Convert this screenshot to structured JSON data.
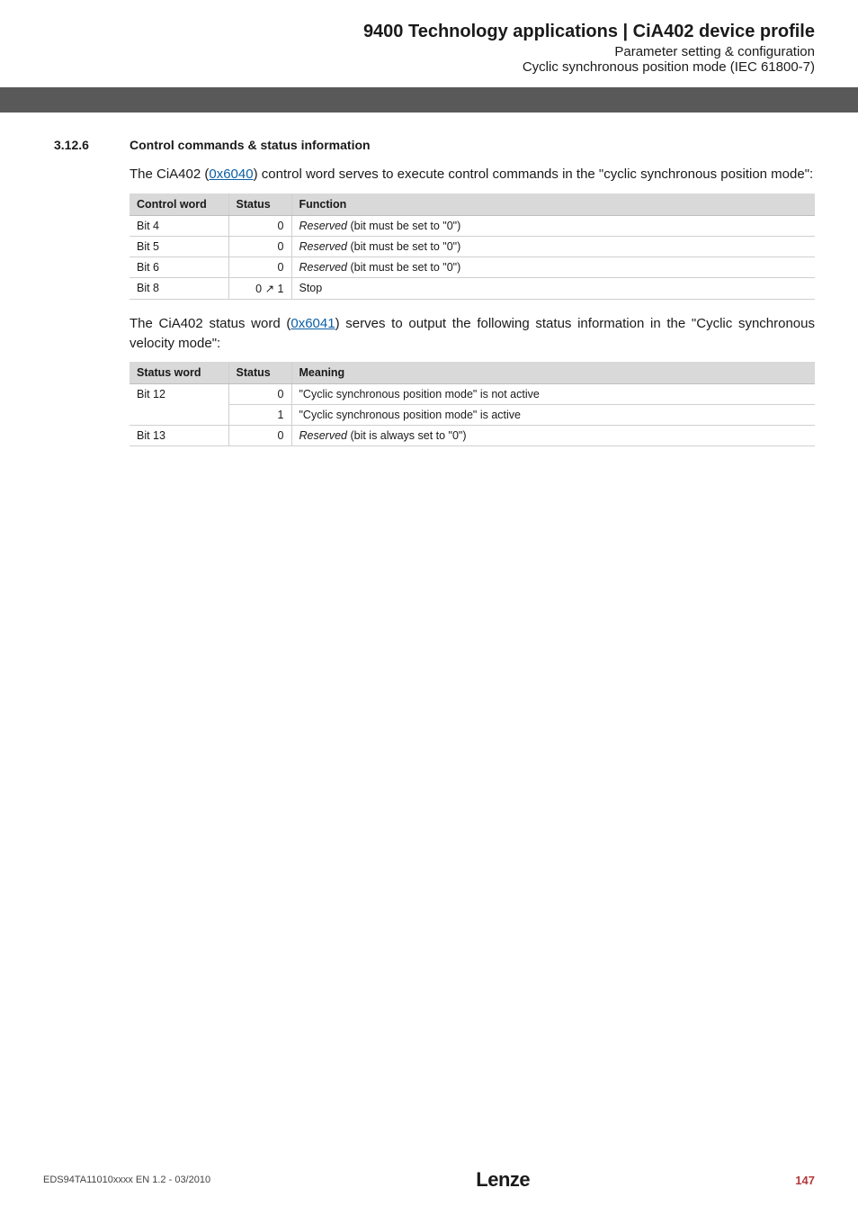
{
  "header": {
    "title": "9400 Technology applications | CiA402 device profile",
    "sub1": "Parameter setting & configuration",
    "sub2": "Cyclic synchronous position mode (IEC 61800-7)"
  },
  "section": {
    "number": "3.12.6",
    "title": "Control commands & status information"
  },
  "para1_parts": {
    "a": "The CiA402 (",
    "link": "0x6040",
    "b": ") control word serves to execute control commands in the \"cyclic synchronous position mode\":"
  },
  "table1": {
    "headers": {
      "c1": "Control word",
      "c2": "Status",
      "c3": "Function"
    },
    "rows": [
      {
        "c1": "Bit 4",
        "c2": "0",
        "c3_i": "Reserved",
        "c3_r": " (bit must be set to \"0\")"
      },
      {
        "c1": "Bit 5",
        "c2": "0",
        "c3_i": "Reserved",
        "c3_r": " (bit must be set to \"0\")"
      },
      {
        "c1": "Bit 6",
        "c2": "0",
        "c3_i": "Reserved",
        "c3_r": " (bit must be set to \"0\")"
      },
      {
        "c1": "Bit 8",
        "c2": "0 ↗ 1",
        "c3_i": "",
        "c3_r": "Stop"
      }
    ]
  },
  "para2_parts": {
    "a": "The CiA402 status word (",
    "link": "0x6041",
    "b": ") serves to output the following status information in the \"Cyclic synchronous velocity mode\":"
  },
  "table2": {
    "headers": {
      "c1": "Status word",
      "c2": "Status",
      "c3": "Meaning"
    },
    "rows": [
      {
        "c1": "Bit 12",
        "c2": "0",
        "c3_i": "",
        "c3_r": "\"Cyclic synchronous position mode\" is not active"
      },
      {
        "c1": "",
        "c2": "1",
        "c3_i": "",
        "c3_r": "\"Cyclic synchronous position mode\" is active"
      },
      {
        "c1": "Bit 13",
        "c2": "0",
        "c3_i": "Reserved",
        "c3_r": " (bit is always set to \"0\")"
      }
    ]
  },
  "footer": {
    "doc": "EDS94TA11010xxxx EN 1.2 - 03/2010",
    "logo": "Lenze",
    "page": "147"
  }
}
